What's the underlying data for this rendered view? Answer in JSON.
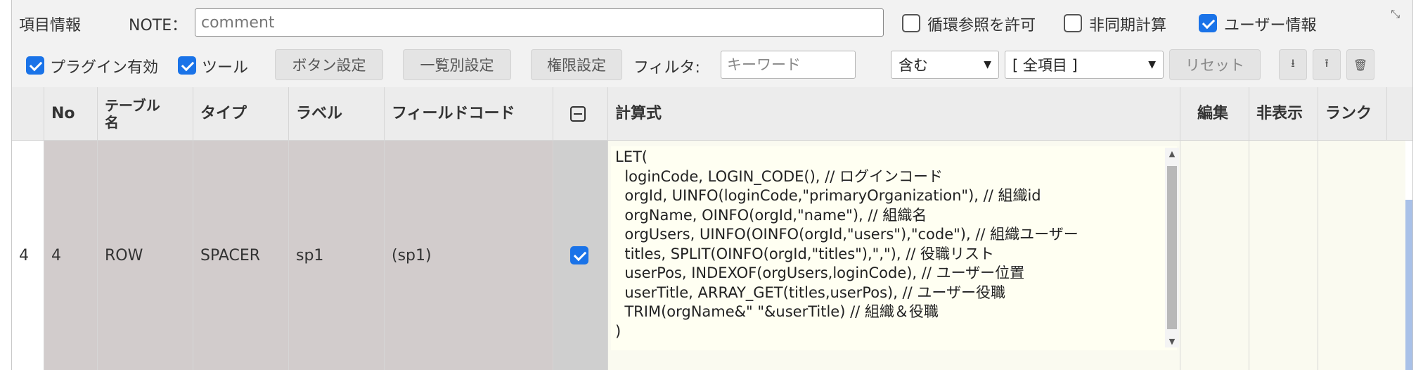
{
  "toolbar1": {
    "section_label": "項目情報",
    "note_label": "NOTE：",
    "note_placeholder": "comment",
    "note_value": "",
    "options": [
      {
        "label": "循環参照を許可",
        "checked": false
      },
      {
        "label": "非同期計算",
        "checked": false
      },
      {
        "label": "ユーザー情報",
        "checked": true
      }
    ]
  },
  "toolbar2": {
    "plugin_enabled": {
      "label": "プラグイン有効",
      "checked": true
    },
    "tool": {
      "label": "ツール",
      "checked": true
    },
    "buttons": [
      "ボタン設定",
      "一覧別設定",
      "権限設定"
    ],
    "filter_label": "フィルタ:",
    "filter_placeholder": "キーワード",
    "filter_mode": "含む",
    "filter_scope": "[ 全項目 ]",
    "reset_label": "リセット",
    "icon_buttons": [
      "download-bottom-icon",
      "upload-top-icon",
      "trash-icon"
    ]
  },
  "grid": {
    "headers": {
      "no": "No",
      "table": "テーブル名",
      "type": "タイプ",
      "label": "ラベル",
      "field_code": "フィールドコード",
      "formula": "計算式",
      "edit": "編集",
      "hidden": "非表示",
      "rank": "ランク"
    },
    "row": {
      "index": "4",
      "no": "4",
      "table": "ROW",
      "type": "SPACER",
      "label": "sp1",
      "field_code": "(sp1)",
      "checked": true,
      "formula": "LET(\n  loginCode, LOGIN_CODE(), // ログインコード\n  orgId, UINFO(loginCode,\"primaryOrganization\"), // 組織id\n  orgName, OINFO(orgId,\"name\"), // 組織名\n  orgUsers, UINFO(OINFO(orgId,\"users\"),\"code\"), // 組織ユーザー\n  titles, SPLIT(OINFO(orgId,\"titles\"),\",\"), // 役職リスト\n  userPos, INDEXOF(orgUsers,loginCode), // ユーザー位置\n  userTitle, ARRAY_GET(titles,userPos), // ユーザー役職\n  TRIM(orgName&\" \"&userTitle) // 組織＆役職\n)"
    }
  }
}
